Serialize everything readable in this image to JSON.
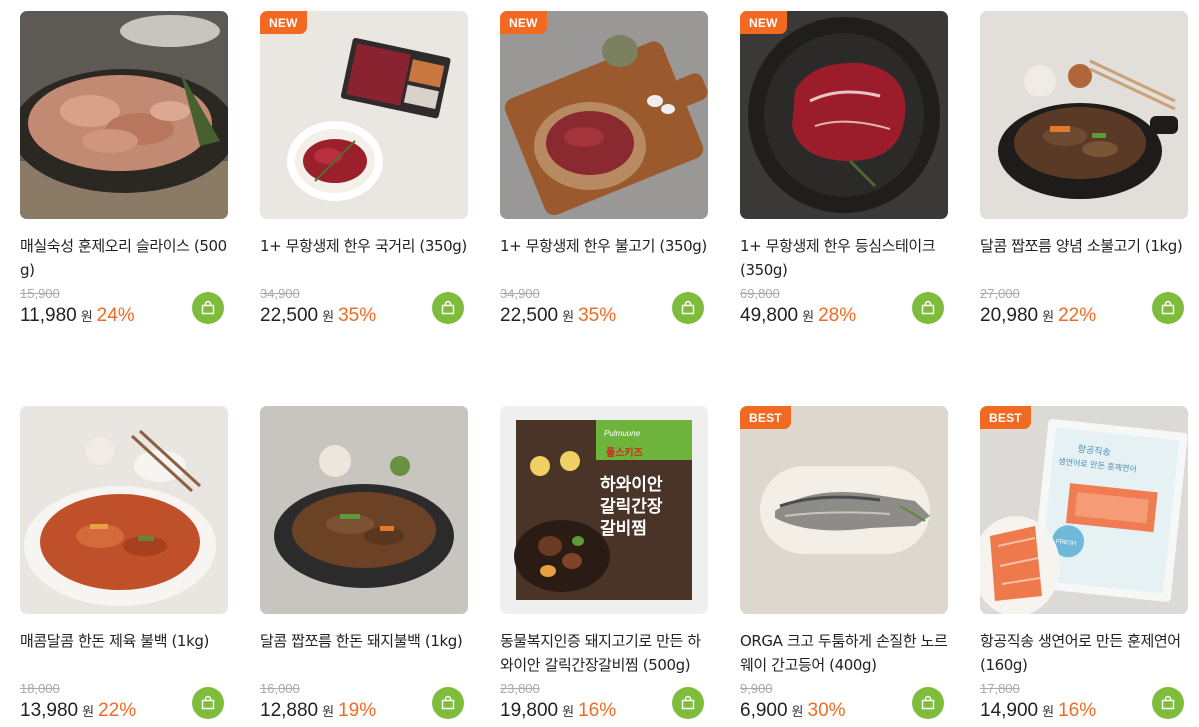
{
  "currency_label": "원",
  "colors": {
    "accent_orange": "#f26a21",
    "cart_green": "#7dbd3b"
  },
  "products": [
    {
      "badge": "",
      "name": "매실숙성 훈제오리 슬라이스 (500g)",
      "original_price": "15,900",
      "price": "11,980",
      "discount": "24%"
    },
    {
      "badge": "NEW",
      "name": "1+ 무항생제 한우 국거리 (350g)",
      "original_price": "34,900",
      "price": "22,500",
      "discount": "35%"
    },
    {
      "badge": "NEW",
      "name": "1+ 무항생제 한우 불고기 (350g)",
      "original_price": "34,900",
      "price": "22,500",
      "discount": "35%"
    },
    {
      "badge": "NEW",
      "name": "1+ 무항생제 한우 등심스테이크 (350g)",
      "original_price": "69,800",
      "price": "49,800",
      "discount": "28%"
    },
    {
      "badge": "",
      "name": "달콤 짭쪼름 양념 소불고기 (1kg)",
      "original_price": "27,000",
      "price": "20,980",
      "discount": "22%"
    },
    {
      "badge": "",
      "name": "매콤달콤 한돈 제육 불백 (1kg)",
      "original_price": "18,000",
      "price": "13,980",
      "discount": "22%"
    },
    {
      "badge": "",
      "name": "달콤 짭쪼름 한돈 돼지불백 (1kg)",
      "original_price": "16,000",
      "price": "12,880",
      "discount": "19%"
    },
    {
      "badge": "",
      "name": "동물복지인증 돼지고기로 만든 하와이안 갈릭간장갈비찜 (500g)",
      "original_price": "23,800",
      "price": "19,800",
      "discount": "16%",
      "package_text": {
        "brand": "Pulmuone",
        "line": "풀스키즈",
        "title1": "하와이안",
        "title2": "갈릭간장",
        "title3": "갈비찜"
      }
    },
    {
      "badge": "BEST",
      "name": "ORGA 크고 두툼하게 손질한 노르웨이 간고등어 (400g)",
      "original_price": "9,900",
      "price": "6,900",
      "discount": "30%"
    },
    {
      "badge": "BEST",
      "name": "항공직송 생연어로 만든 훈제연어 (160g)",
      "original_price": "17,800",
      "price": "14,900",
      "discount": "16%",
      "package_text": {
        "title1": "항공직송",
        "title2": "생연어로 만든 훈제연어",
        "label": "FRESH"
      }
    }
  ]
}
